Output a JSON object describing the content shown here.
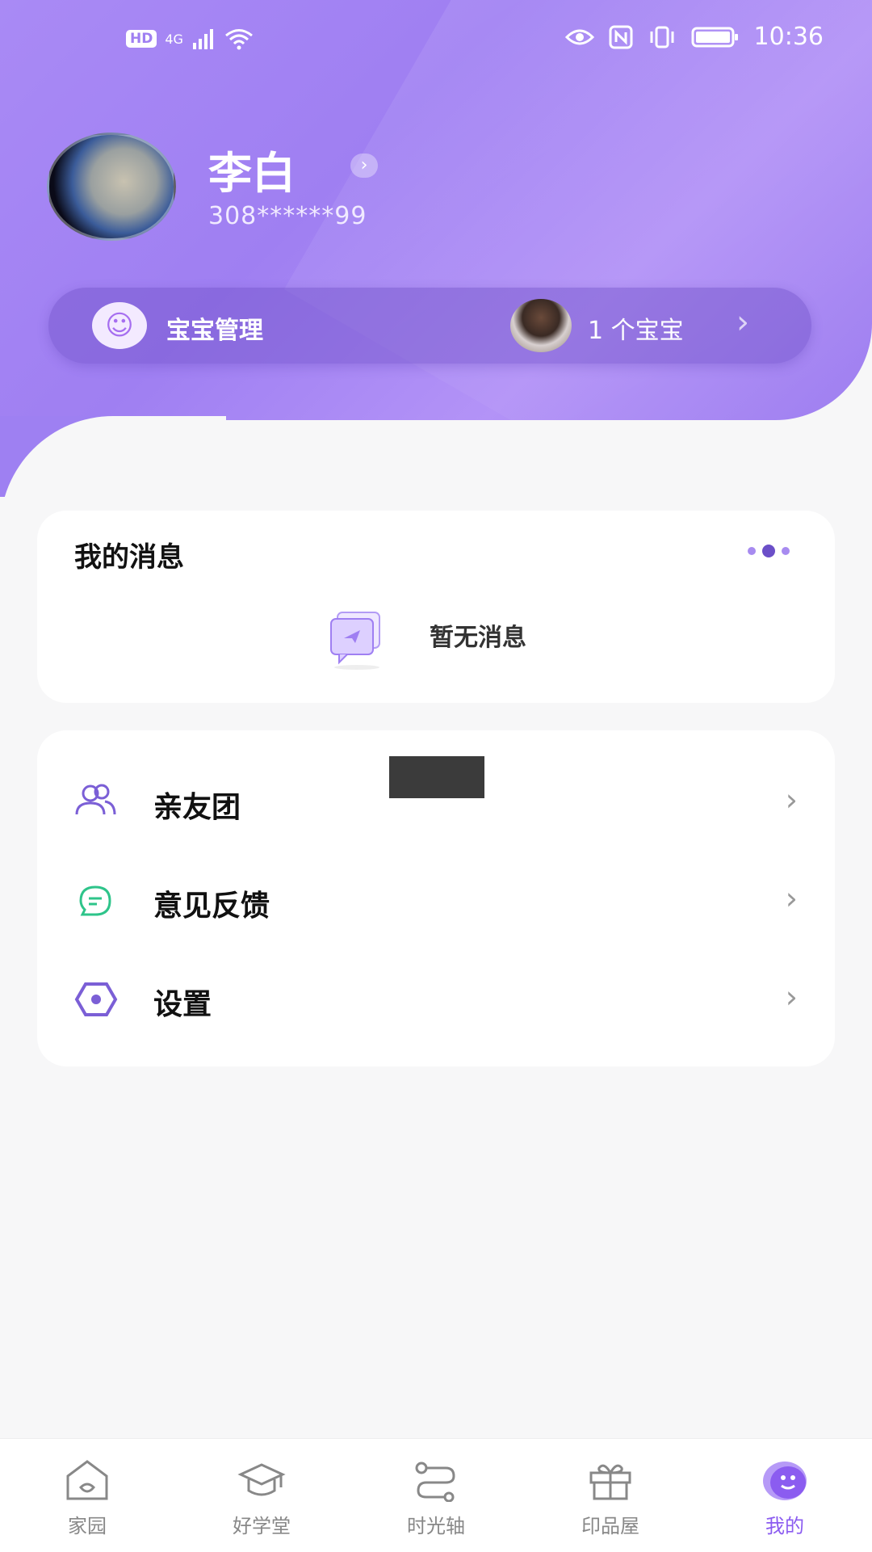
{
  "status_bar": {
    "network": "4G",
    "hd": "HD",
    "time": "10:36"
  },
  "profile": {
    "name": "李白",
    "phone": "308******99"
  },
  "baby_bar": {
    "label": "宝宝管理",
    "count_text": "1 个宝宝"
  },
  "messages": {
    "title": "我的消息",
    "empty_text": "暂无消息"
  },
  "menu": [
    {
      "label": "亲友团",
      "icon": "friends-icon",
      "color": "#7b5fd6"
    },
    {
      "label": "意见反馈",
      "icon": "feedback-icon",
      "color": "#2ec48a"
    },
    {
      "label": "设置",
      "icon": "settings-icon",
      "color": "#7b5fd6"
    }
  ],
  "tabs": [
    {
      "label": "家园",
      "icon": "home-icon",
      "active": false
    },
    {
      "label": "好学堂",
      "icon": "graduation-cap-icon",
      "active": false
    },
    {
      "label": "时光轴",
      "icon": "timeline-icon",
      "active": false
    },
    {
      "label": "印品屋",
      "icon": "gift-icon",
      "active": false
    },
    {
      "label": "我的",
      "icon": "smiley-icon",
      "active": true
    }
  ],
  "colors": {
    "accent": "#9f7ff2",
    "active_tab": "#8b5cf0",
    "background": "#f7f7f8"
  }
}
